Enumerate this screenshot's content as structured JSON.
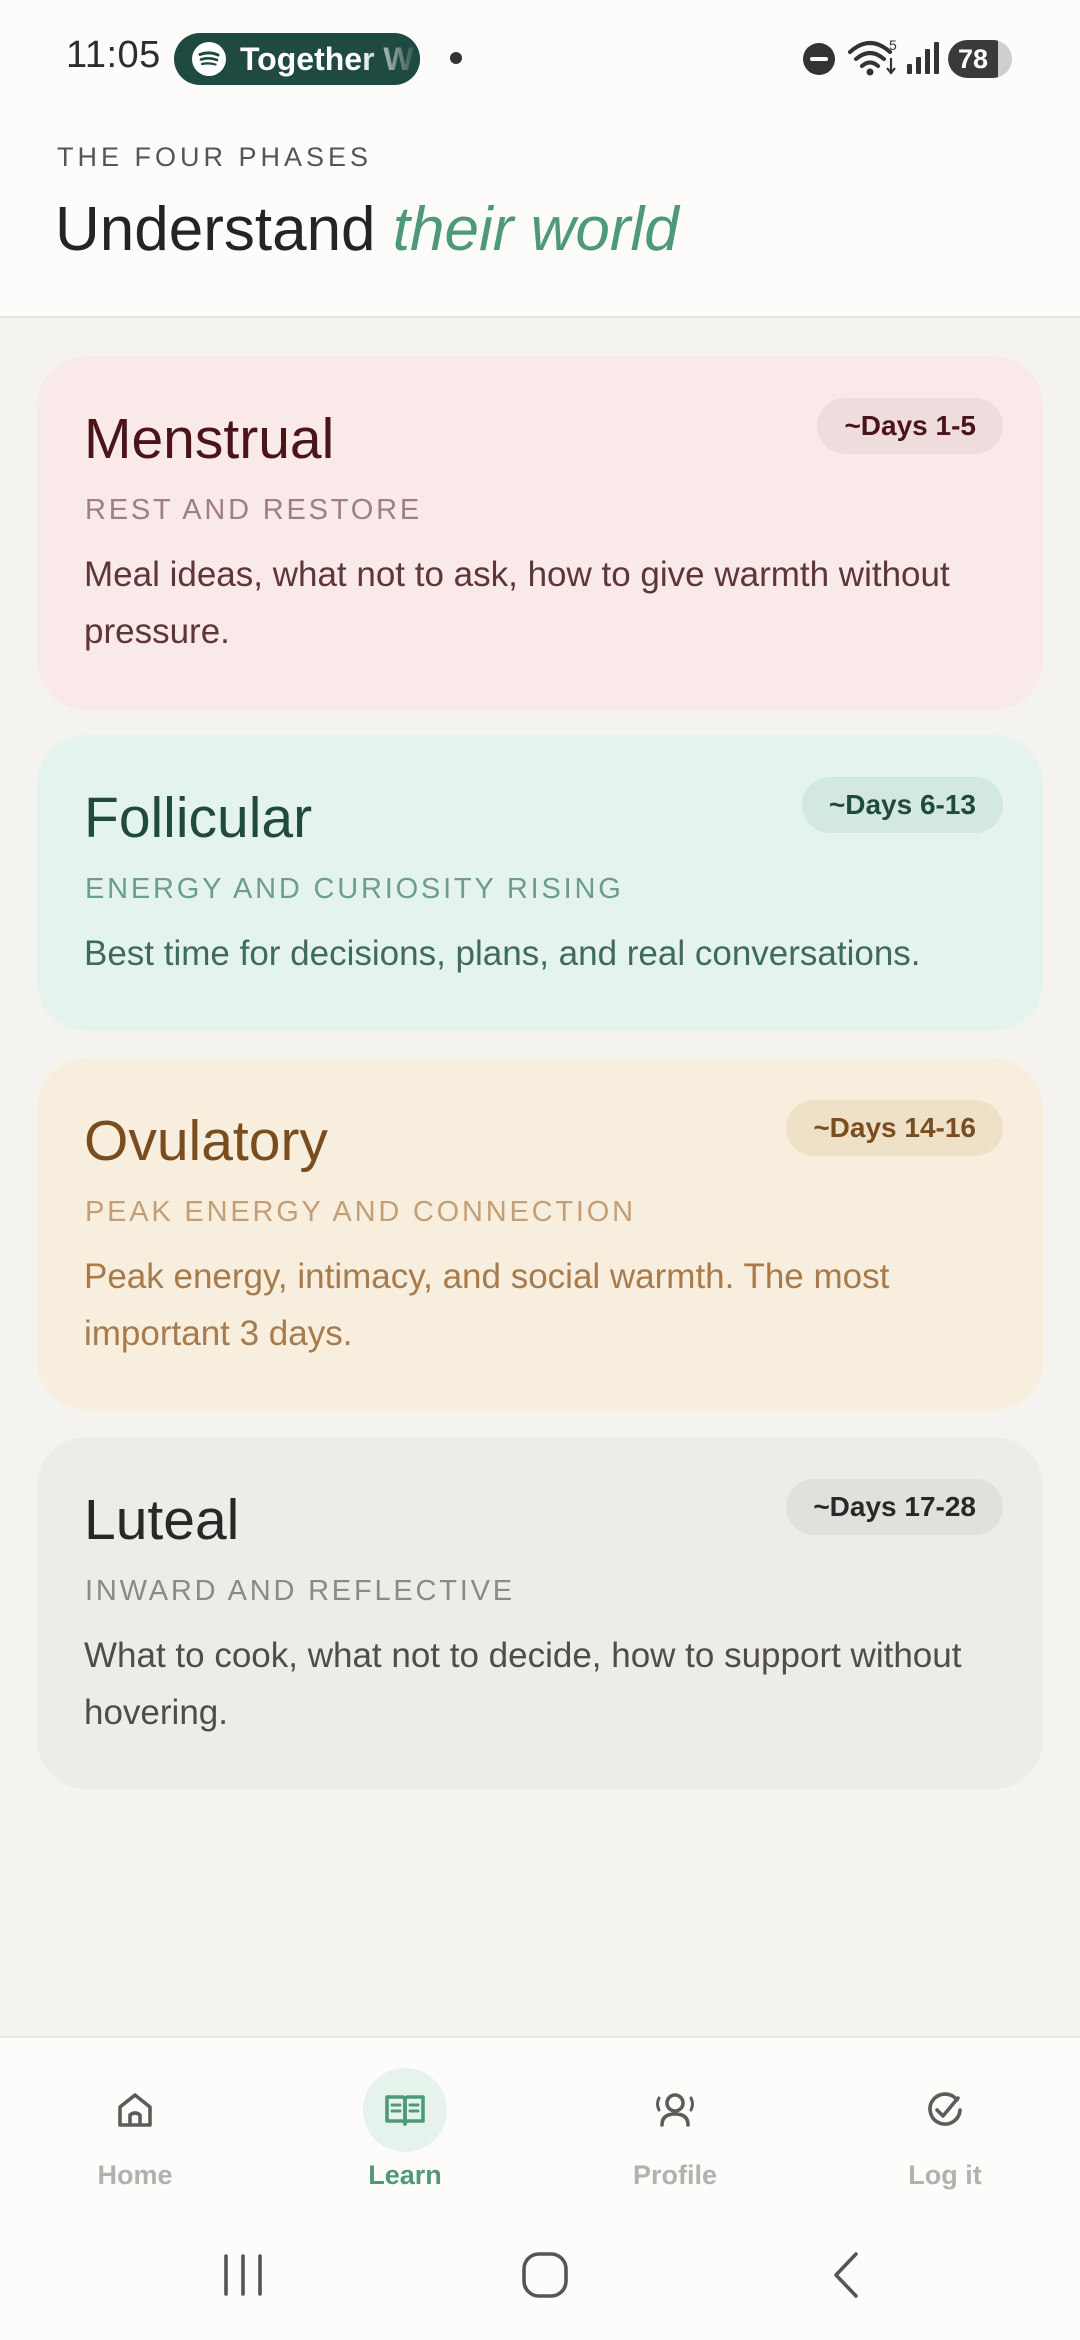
{
  "status_bar": {
    "time": "11:05",
    "media_pill": "Together W",
    "battery_level": 78,
    "battery_text": "78",
    "icons": [
      "spotify-icon",
      "dnd-icon",
      "wifi-icon",
      "signal-icon",
      "battery-icon"
    ]
  },
  "header": {
    "eyebrow": "THE FOUR PHASES",
    "title_main": "Understand ",
    "title_accent": "their world",
    "accent_color": "#4e9a78"
  },
  "phases": [
    {
      "name": "Menstrual",
      "days": "~Days 1-5",
      "subtitle": "REST AND RESTORE",
      "description": "Meal ideas, what not to ask, how to give warmth without pressure.",
      "color": "#f9e9e9"
    },
    {
      "name": "Follicular",
      "days": "~Days 6-13",
      "subtitle": "ENERGY AND CURIOSITY RISING",
      "description": "Best time for decisions, plans, and real conversations.",
      "color": "#e5f3ee"
    },
    {
      "name": "Ovulatory",
      "days": "~Days 14-16",
      "subtitle": "PEAK ENERGY AND CONNECTION",
      "description": "Peak energy, intimacy, and social warmth. The most important 3 days.",
      "color": "#f8eedd"
    },
    {
      "name": "Luteal",
      "days": "~Days 17-28",
      "subtitle": "INWARD AND REFLECTIVE",
      "description": "What to cook, what not to decide, how to support without hovering.",
      "color": "#eeece8"
    }
  ],
  "bottom_nav": {
    "active": "Learn",
    "items": [
      {
        "label": "Home",
        "icon": "home-icon"
      },
      {
        "label": "Learn",
        "icon": "book-icon"
      },
      {
        "label": "Profile",
        "icon": "profile-icon"
      },
      {
        "label": "Log it",
        "icon": "check-circle-icon"
      }
    ]
  },
  "system_nav": {
    "icons": [
      "recents-icon",
      "home-circle-icon",
      "back-icon"
    ]
  }
}
